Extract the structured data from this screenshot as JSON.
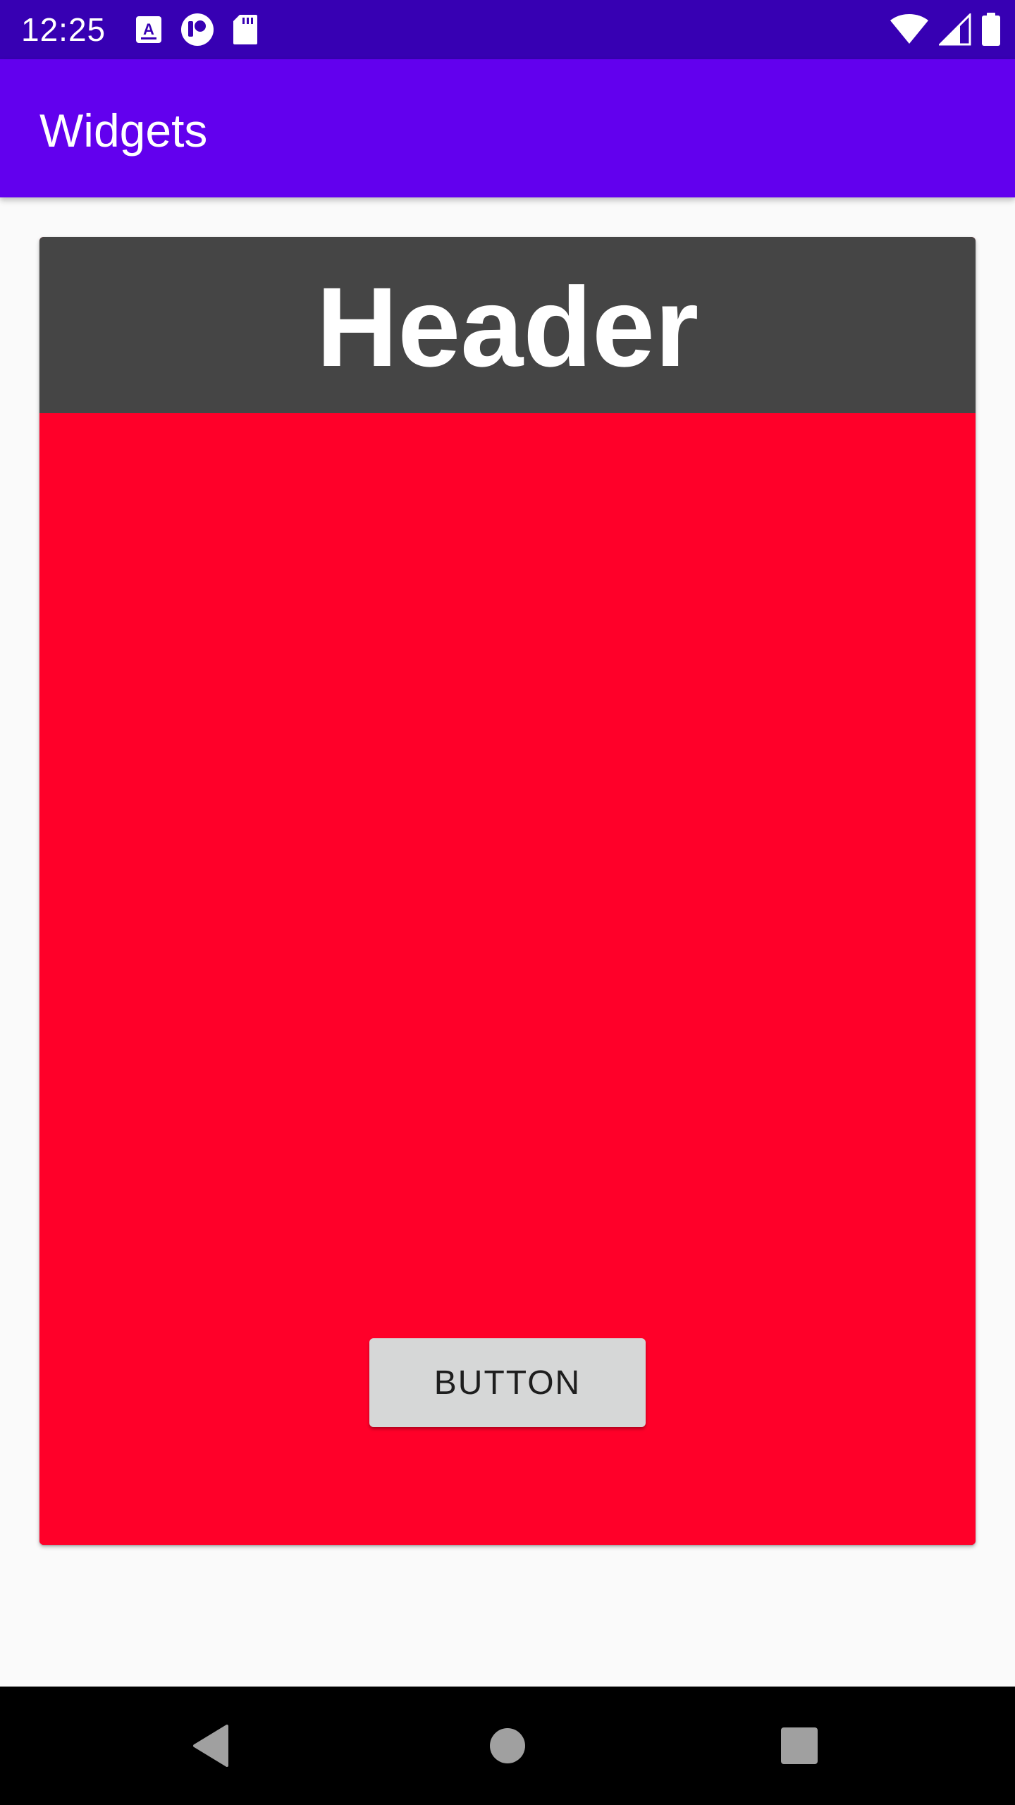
{
  "status_bar": {
    "time": "12:25",
    "left_icons": [
      "a-notification-icon",
      "circle-notification-icon",
      "sd-card-icon"
    ],
    "right_icons": [
      "wifi-icon",
      "cell-signal-icon",
      "battery-icon"
    ]
  },
  "app_bar": {
    "title": "Widgets"
  },
  "card": {
    "header_text": "Header",
    "button_label": "BUTTON"
  },
  "nav_bar": {
    "buttons": [
      "back-icon",
      "home-icon",
      "recents-icon"
    ]
  },
  "colors": {
    "status_bar": "#3700b3",
    "app_bar": "#6200ee",
    "card_header": "#454545",
    "card_body": "#ff0029",
    "button": "#d6d7d7",
    "background": "#fafafa"
  }
}
